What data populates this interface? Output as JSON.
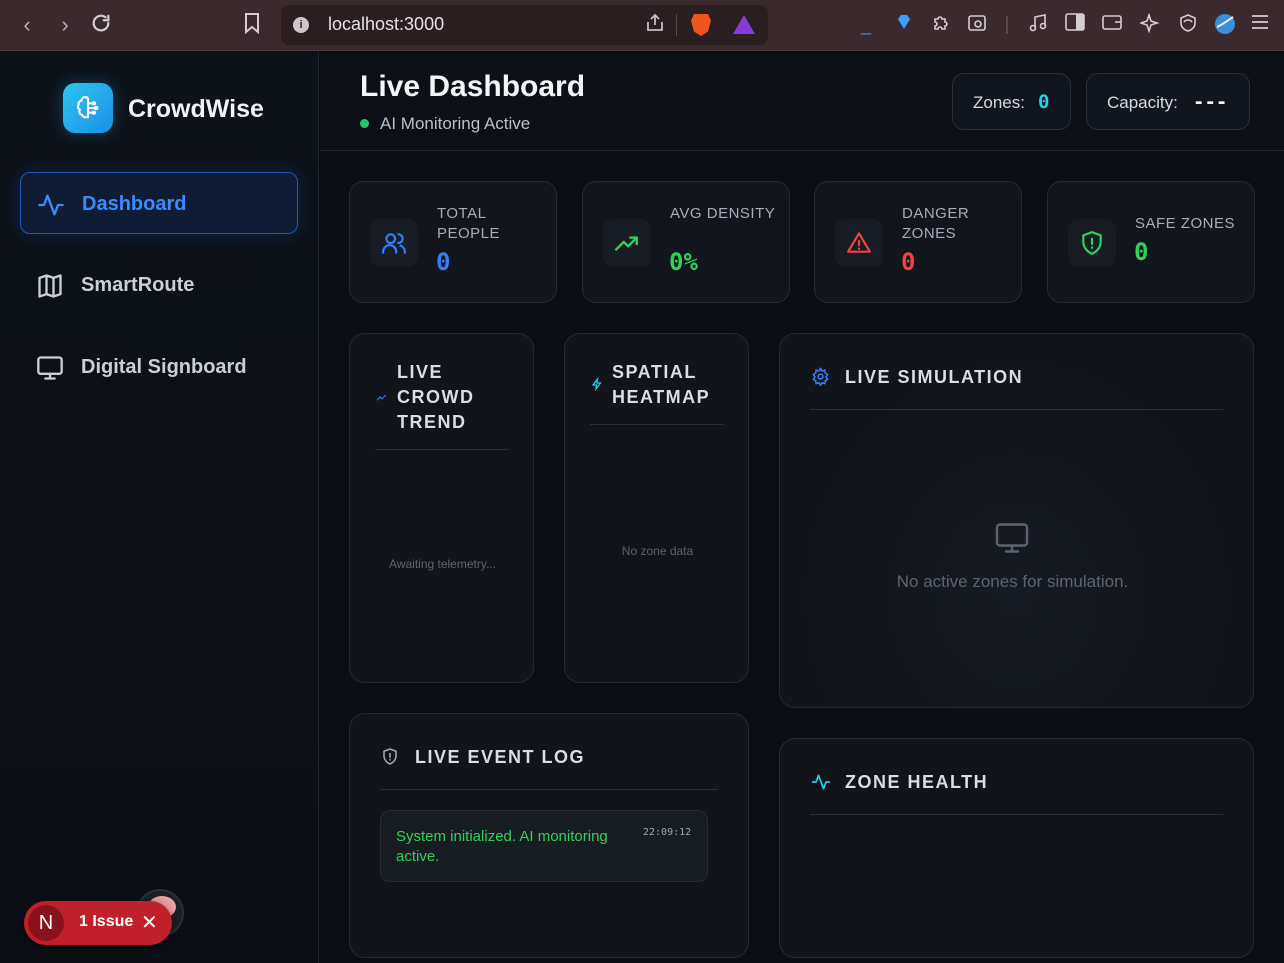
{
  "browser": {
    "url": "localhost:3000"
  },
  "app": {
    "brand": "CrowdWise"
  },
  "sidebar": {
    "items": [
      {
        "label": "Dashboard",
        "icon": "activity-icon",
        "active": true
      },
      {
        "label": "SmartRoute",
        "icon": "map-icon",
        "active": false
      },
      {
        "label": "Digital Signboard",
        "icon": "monitor-icon",
        "active": false
      }
    ]
  },
  "header": {
    "title": "Live Dashboard",
    "status": "AI Monitoring Active",
    "zones_label": "Zones:",
    "zones_value": "0",
    "capacity_label": "Capacity:",
    "capacity_value": "---"
  },
  "stats": [
    {
      "label": "TOTAL PEOPLE",
      "value": "0",
      "icon": "users-icon",
      "color": "#2f80ff"
    },
    {
      "label": "AVG DENSITY",
      "value": "0%",
      "icon": "trending-up-icon",
      "color": "#2fd15a"
    },
    {
      "label": "DANGER ZONES",
      "value": "0",
      "icon": "alert-triangle-icon",
      "color": "#ef4444"
    },
    {
      "label": "SAFE ZONES",
      "value": "0",
      "icon": "shield-icon",
      "color": "#2fd15a"
    }
  ],
  "panels": {
    "trend": {
      "title": "LIVE CROWD TREND",
      "empty": "Awaiting telemetry..."
    },
    "heatmap": {
      "title": "SPATIAL HEATMAP",
      "empty": "No zone data"
    },
    "simulation": {
      "title": "LIVE SIMULATION",
      "empty": "No active zones for simulation."
    },
    "log": {
      "title": "LIVE EVENT LOG",
      "entries": [
        {
          "message": "System initialized. AI monitoring active.",
          "time": "22:09:12"
        }
      ]
    },
    "health": {
      "title": "ZONE HEALTH"
    }
  },
  "devtools": {
    "issue_label": "1 Issue",
    "n_badge": "N"
  }
}
